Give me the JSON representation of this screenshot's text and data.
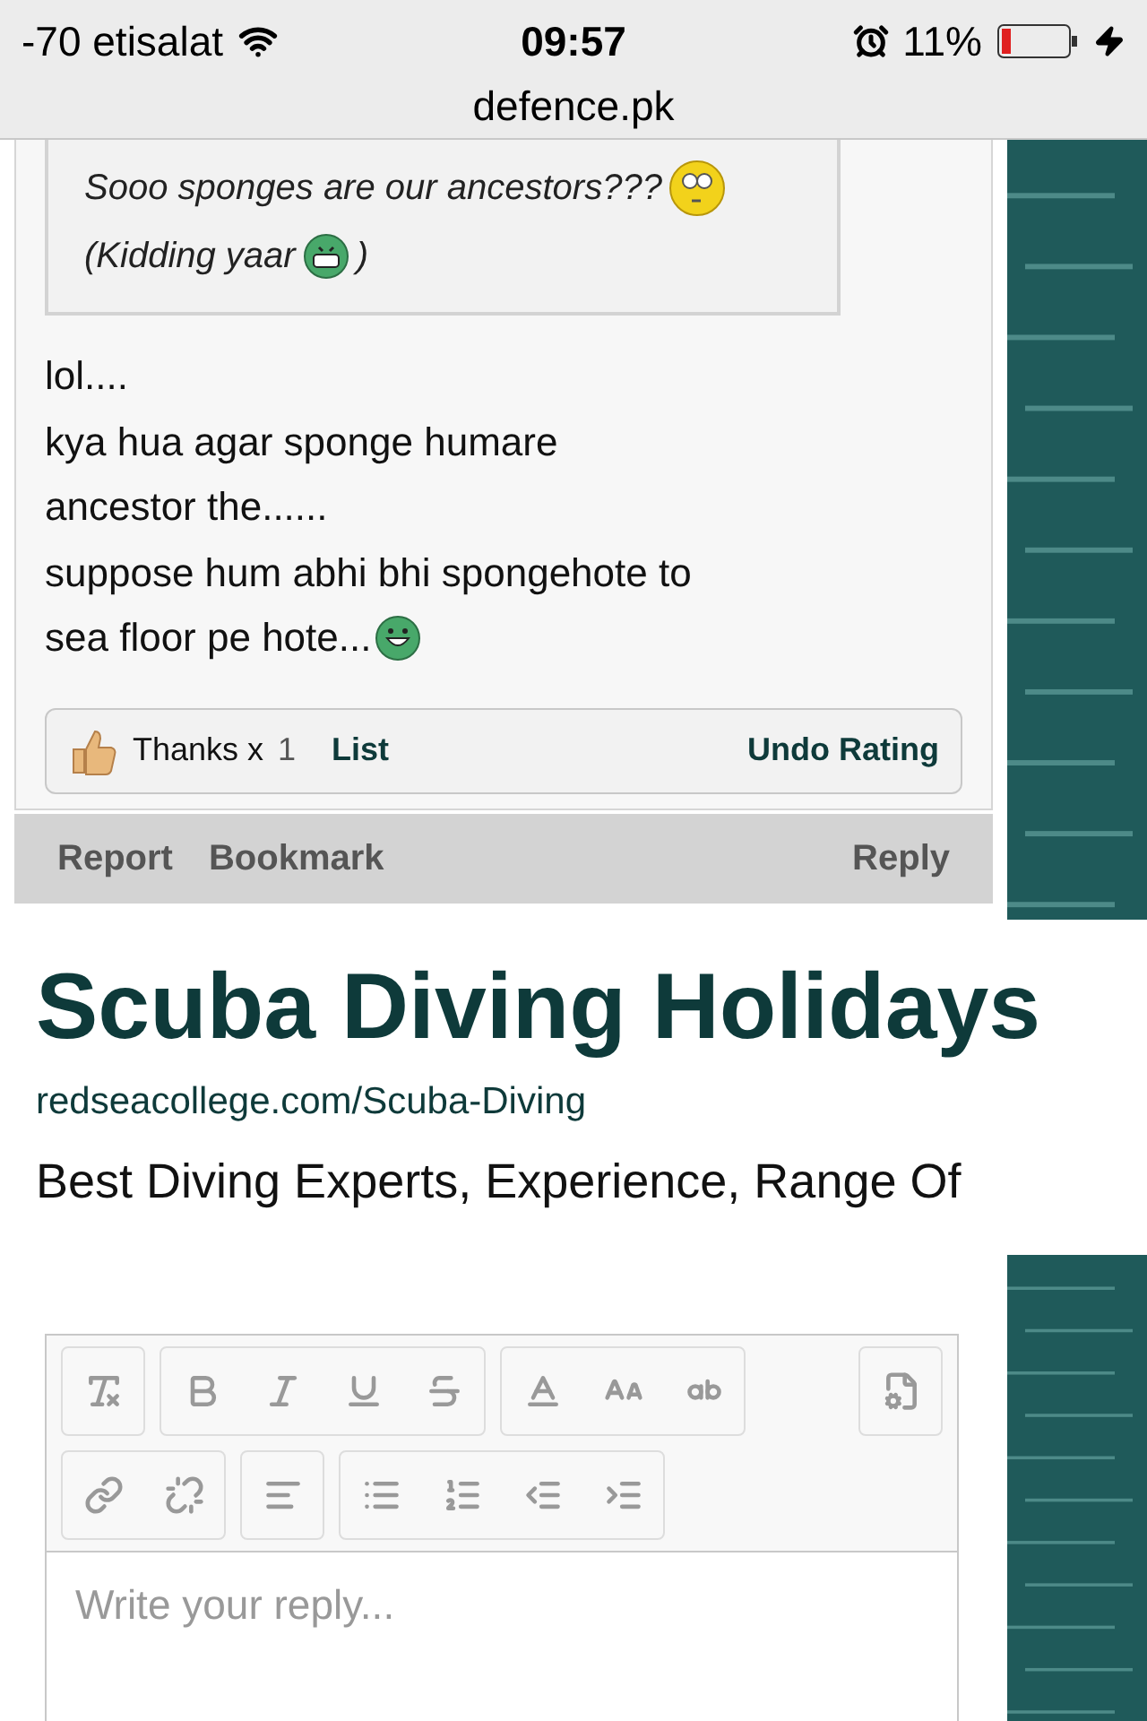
{
  "status_bar": {
    "carrier": "-70 etisalat",
    "time": "09:57",
    "battery": "11%",
    "url": "defence.pk"
  },
  "post": {
    "quote": [
      {
        "text": "Sooo sponges are our ancestors???",
        "kind": "confused"
      },
      {
        "text": "(Kidding yaar",
        "kind": "grin",
        "after": ")"
      }
    ],
    "body": [
      {
        "text": "lol....",
        "kind": "plain"
      },
      {
        "text": "kya hua agar sponge humare",
        "kind": "plain"
      },
      {
        "text": "ancestor the......",
        "kind": "plain"
      },
      {
        "text": "suppose hum abhi bhi spongehote to",
        "kind": "plain"
      },
      {
        "text": "sea floor pe hote...",
        "kind": "smile"
      }
    ],
    "rating": {
      "label": "Thanks x",
      "count": "1",
      "list": "List",
      "undo": "Undo Rating"
    },
    "actions": {
      "left": [
        "Report",
        "Bookmark"
      ],
      "right": "Reply"
    }
  },
  "ad": {
    "title": "Scuba Diving Holidays",
    "url": "redseacollege.com/Scuba-Diving",
    "description": "Best Diving Experts, Experience, Range Of"
  },
  "editor": {
    "toolbar": [
      [
        [
          {
            "kind": "clear-format"
          }
        ],
        [
          {
            "kind": "bold"
          },
          {
            "kind": "italic"
          },
          {
            "kind": "underline"
          },
          {
            "kind": "strike"
          }
        ],
        [
          {
            "kind": "text-color"
          },
          {
            "kind": "font-size"
          },
          {
            "kind": "case"
          }
        ],
        [
          {
            "kind": "source"
          }
        ]
      ],
      [
        [
          {
            "kind": "link"
          },
          {
            "kind": "unlink"
          }
        ],
        [
          {
            "kind": "align"
          }
        ],
        [
          {
            "kind": "bullets"
          },
          {
            "kind": "numbers"
          },
          {
            "kind": "outdent"
          },
          {
            "kind": "indent"
          }
        ]
      ]
    ],
    "placeholder": "Write your reply..."
  }
}
